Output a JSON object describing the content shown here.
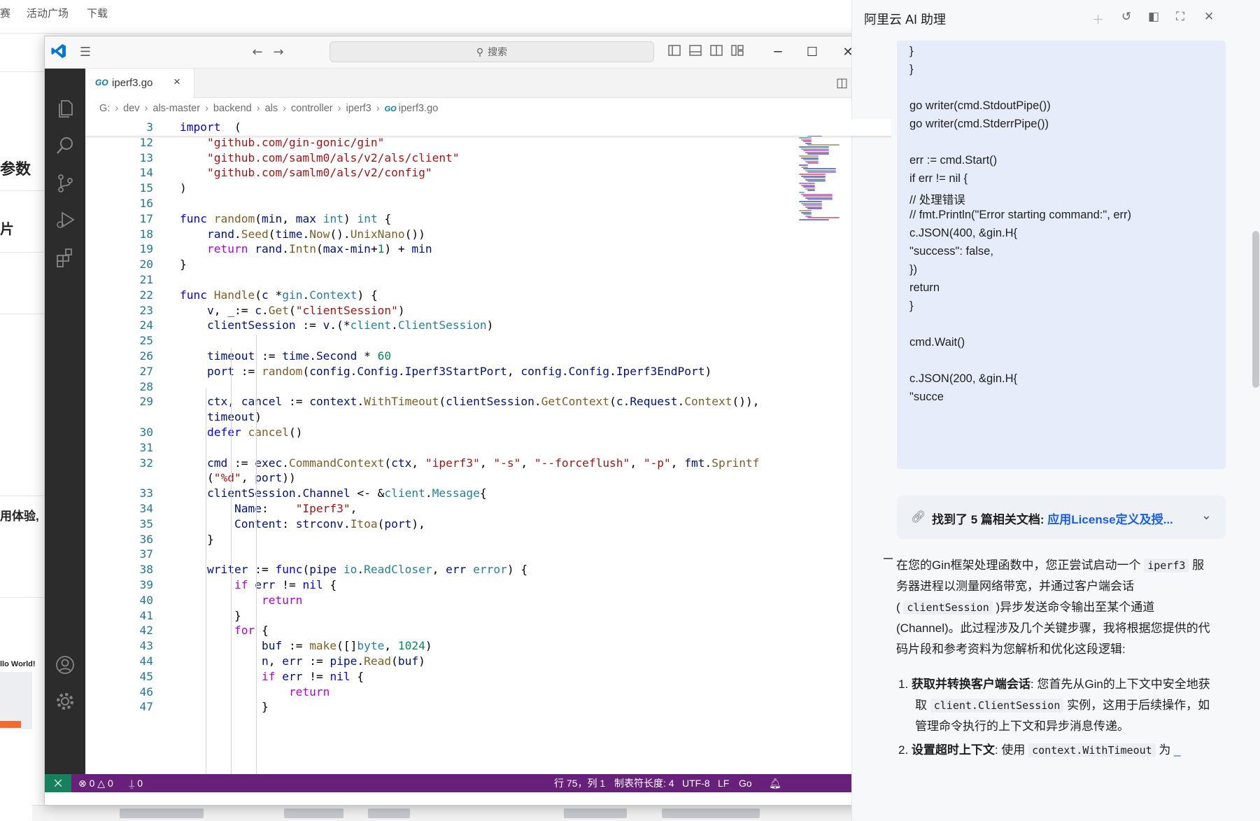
{
  "background": {
    "tabs": [
      "赛",
      "活动广场",
      "下载"
    ],
    "left_texts": [
      "参数",
      "片",
      "用体验,",
      "llo World!"
    ]
  },
  "vscode": {
    "search_placeholder": "搜索",
    "tab": {
      "icon": "go-file-icon",
      "go_mark": "GO",
      "filename": "iperf3.go",
      "close": "×"
    },
    "breadcrumb": [
      "G:",
      "dev",
      "als-master",
      "backend",
      "als",
      "controller",
      "iperf3",
      "iperf3.go"
    ],
    "status": {
      "errors": "0",
      "warnings": "0",
      "ports": "0",
      "position": "行 75，列 1",
      "tab_size": "制表符长度: 4",
      "encoding": "UTF-8",
      "eol": "LF",
      "language": "Go"
    }
  },
  "code_lines": [
    {
      "ln": "3",
      "tokens": [
        [
          "kw",
          "import"
        ],
        [
          "",
          "  ("
        ]
      ]
    },
    {
      "ln": "12",
      "tokens": [
        [
          "",
          "    "
        ],
        [
          "str",
          "\"github.com/gin-gonic/gin\""
        ]
      ]
    },
    {
      "ln": "13",
      "tokens": [
        [
          "",
          "    "
        ],
        [
          "str",
          "\"github.com/samlm0/als/v2/als/client\""
        ]
      ]
    },
    {
      "ln": "14",
      "tokens": [
        [
          "",
          "    "
        ],
        [
          "str",
          "\"github.com/samlm0/als/v2/config\""
        ]
      ]
    },
    {
      "ln": "15",
      "tokens": [
        [
          "",
          ")"
        ]
      ]
    },
    {
      "ln": "16",
      "tokens": []
    },
    {
      "ln": "17",
      "tokens": [
        [
          "kw",
          "func"
        ],
        [
          "",
          " "
        ],
        [
          "fn",
          "random"
        ],
        [
          "",
          "("
        ],
        [
          "id",
          "min"
        ],
        [
          "",
          ", "
        ],
        [
          "id",
          "max"
        ],
        [
          "",
          " "
        ],
        [
          "ty",
          "int"
        ],
        [
          "",
          ") "
        ],
        [
          "ty",
          "int"
        ],
        [
          "",
          " {"
        ]
      ]
    },
    {
      "ln": "18",
      "tokens": [
        [
          "",
          "    "
        ],
        [
          "id",
          "rand"
        ],
        [
          "",
          "."
        ],
        [
          "fn",
          "Seed"
        ],
        [
          "",
          "("
        ],
        [
          "id",
          "time"
        ],
        [
          "",
          "."
        ],
        [
          "fn",
          "Now"
        ],
        [
          "",
          "()."
        ],
        [
          "fn",
          "UnixNano"
        ],
        [
          "",
          "())"
        ]
      ]
    },
    {
      "ln": "19",
      "tokens": [
        [
          "",
          "    "
        ],
        [
          "ctl",
          "return"
        ],
        [
          "",
          " "
        ],
        [
          "id",
          "rand"
        ],
        [
          "",
          "."
        ],
        [
          "fn",
          "Intn"
        ],
        [
          "",
          "("
        ],
        [
          "id",
          "max"
        ],
        [
          "",
          "-"
        ],
        [
          "id",
          "min"
        ],
        [
          "",
          "+"
        ],
        [
          "num",
          "1"
        ],
        [
          "",
          ") + "
        ],
        [
          "id",
          "min"
        ]
      ]
    },
    {
      "ln": "20",
      "tokens": [
        [
          "",
          "}"
        ]
      ]
    },
    {
      "ln": "21",
      "tokens": []
    },
    {
      "ln": "22",
      "tokens": [
        [
          "kw",
          "func"
        ],
        [
          "",
          " "
        ],
        [
          "fn",
          "Handle"
        ],
        [
          "",
          "("
        ],
        [
          "id",
          "c"
        ],
        [
          "",
          " *"
        ],
        [
          "ty",
          "gin"
        ],
        [
          "",
          "."
        ],
        [
          "ty",
          "Context"
        ],
        [
          "",
          ") {"
        ]
      ]
    },
    {
      "ln": "23",
      "tokens": [
        [
          "",
          "    "
        ],
        [
          "id",
          "v"
        ],
        [
          "",
          ", "
        ],
        [
          "id",
          "_"
        ],
        [
          "",
          ":= "
        ],
        [
          "id",
          "c"
        ],
        [
          "",
          "."
        ],
        [
          "fn",
          "Get"
        ],
        [
          "",
          "("
        ],
        [
          "str",
          "\"clientSession\""
        ],
        [
          "",
          ")"
        ]
      ]
    },
    {
      "ln": "24",
      "tokens": [
        [
          "",
          "    "
        ],
        [
          "id",
          "clientSession"
        ],
        [
          "",
          " := "
        ],
        [
          "id",
          "v"
        ],
        [
          "",
          ".(*"
        ],
        [
          "ty",
          "client"
        ],
        [
          "",
          "."
        ],
        [
          "ty",
          "ClientSession"
        ],
        [
          "",
          ")"
        ]
      ]
    },
    {
      "ln": "25",
      "tokens": []
    },
    {
      "ln": "26",
      "tokens": [
        [
          "",
          "    "
        ],
        [
          "id",
          "timeout"
        ],
        [
          "",
          " := "
        ],
        [
          "id",
          "time"
        ],
        [
          "",
          "."
        ],
        [
          "id",
          "Second"
        ],
        [
          "",
          " * "
        ],
        [
          "num",
          "60"
        ]
      ]
    },
    {
      "ln": "27",
      "tokens": [
        [
          "",
          "    "
        ],
        [
          "id",
          "port"
        ],
        [
          "",
          " := "
        ],
        [
          "fn",
          "random"
        ],
        [
          "",
          "("
        ],
        [
          "id",
          "config"
        ],
        [
          "",
          "."
        ],
        [
          "id",
          "Config"
        ],
        [
          "",
          "."
        ],
        [
          "id",
          "Iperf3StartPort"
        ],
        [
          "",
          ", "
        ],
        [
          "id",
          "config"
        ],
        [
          "",
          "."
        ],
        [
          "id",
          "Config"
        ],
        [
          "",
          "."
        ],
        [
          "id",
          "Iperf3EndPort"
        ],
        [
          "",
          ")"
        ]
      ]
    },
    {
      "ln": "28",
      "tokens": []
    },
    {
      "ln": "29",
      "tokens": [
        [
          "",
          "    "
        ],
        [
          "id",
          "ctx"
        ],
        [
          "",
          ", "
        ],
        [
          "id",
          "cancel"
        ],
        [
          "",
          " := "
        ],
        [
          "id",
          "context"
        ],
        [
          "",
          "."
        ],
        [
          "fn",
          "WithTimeout"
        ],
        [
          "",
          "("
        ],
        [
          "id",
          "clientSession"
        ],
        [
          "",
          "."
        ],
        [
          "fn",
          "GetContext"
        ],
        [
          "",
          "("
        ],
        [
          "id",
          "c"
        ],
        [
          "",
          "."
        ],
        [
          "id",
          "Request"
        ],
        [
          "",
          "."
        ],
        [
          "fn",
          "Context"
        ],
        [
          "",
          "()),"
        ]
      ]
    },
    {
      "ln": "",
      "tokens": [
        [
          "",
          "    "
        ],
        [
          "id",
          "timeout"
        ],
        [
          "",
          ")"
        ]
      ]
    },
    {
      "ln": "30",
      "tokens": [
        [
          "",
          "    "
        ],
        [
          "kw",
          "defer"
        ],
        [
          "",
          " "
        ],
        [
          "fn",
          "cancel"
        ],
        [
          "",
          "()"
        ]
      ]
    },
    {
      "ln": "31",
      "tokens": []
    },
    {
      "ln": "32",
      "tokens": [
        [
          "",
          "    "
        ],
        [
          "id",
          "cmd"
        ],
        [
          "",
          " := "
        ],
        [
          "id",
          "exec"
        ],
        [
          "",
          "."
        ],
        [
          "fn",
          "CommandContext"
        ],
        [
          "",
          "("
        ],
        [
          "id",
          "ctx"
        ],
        [
          "",
          ", "
        ],
        [
          "str",
          "\"iperf3\""
        ],
        [
          "",
          ", "
        ],
        [
          "str",
          "\"-s\""
        ],
        [
          "",
          ", "
        ],
        [
          "str",
          "\"--forceflush\""
        ],
        [
          "",
          ", "
        ],
        [
          "str",
          "\"-p\""
        ],
        [
          "",
          ", "
        ],
        [
          "id",
          "fmt"
        ],
        [
          "",
          "."
        ],
        [
          "fn",
          "Sprintf"
        ]
      ]
    },
    {
      "ln": "",
      "tokens": [
        [
          "",
          "    ("
        ],
        [
          "str",
          "\"%d\""
        ],
        [
          "",
          ", "
        ],
        [
          "id",
          "port"
        ],
        [
          "",
          "))"
        ]
      ]
    },
    {
      "ln": "33",
      "tokens": [
        [
          "",
          "    "
        ],
        [
          "id",
          "clientSession"
        ],
        [
          "",
          "."
        ],
        [
          "id",
          "Channel"
        ],
        [
          "",
          " <- &"
        ],
        [
          "ty",
          "client"
        ],
        [
          "",
          "."
        ],
        [
          "ty",
          "Message"
        ],
        [
          "",
          "{"
        ]
      ]
    },
    {
      "ln": "34",
      "tokens": [
        [
          "",
          "        "
        ],
        [
          "id",
          "Name"
        ],
        [
          "",
          ":    "
        ],
        [
          "str",
          "\"Iperf3\""
        ],
        [
          "",
          ","
        ]
      ]
    },
    {
      "ln": "35",
      "tokens": [
        [
          "",
          "        "
        ],
        [
          "id",
          "Content"
        ],
        [
          "",
          ": "
        ],
        [
          "id",
          "strconv"
        ],
        [
          "",
          "."
        ],
        [
          "fn",
          "Itoa"
        ],
        [
          "",
          "("
        ],
        [
          "id",
          "port"
        ],
        [
          "",
          "),"
        ]
      ]
    },
    {
      "ln": "36",
      "tokens": [
        [
          "",
          "    }"
        ]
      ]
    },
    {
      "ln": "37",
      "tokens": []
    },
    {
      "ln": "38",
      "tokens": [
        [
          "",
          "    "
        ],
        [
          "id",
          "writer"
        ],
        [
          "",
          " := "
        ],
        [
          "kw",
          "func"
        ],
        [
          "",
          "("
        ],
        [
          "id",
          "pipe"
        ],
        [
          "",
          " "
        ],
        [
          "ty",
          "io"
        ],
        [
          "",
          "."
        ],
        [
          "ty",
          "ReadCloser"
        ],
        [
          "",
          ", "
        ],
        [
          "id",
          "err"
        ],
        [
          "",
          " "
        ],
        [
          "ty",
          "error"
        ],
        [
          "",
          ") {"
        ]
      ]
    },
    {
      "ln": "39",
      "tokens": [
        [
          "",
          "        "
        ],
        [
          "ctl",
          "if"
        ],
        [
          "",
          " "
        ],
        [
          "id",
          "err"
        ],
        [
          "",
          " != "
        ],
        [
          "kw",
          "nil"
        ],
        [
          "",
          " {"
        ]
      ]
    },
    {
      "ln": "40",
      "tokens": [
        [
          "",
          "            "
        ],
        [
          "ctl",
          "return"
        ]
      ]
    },
    {
      "ln": "41",
      "tokens": [
        [
          "",
          "        }"
        ]
      ]
    },
    {
      "ln": "42",
      "tokens": [
        [
          "",
          "        "
        ],
        [
          "ctl",
          "for"
        ],
        [
          "",
          " {"
        ]
      ]
    },
    {
      "ln": "43",
      "tokens": [
        [
          "",
          "            "
        ],
        [
          "id",
          "buf"
        ],
        [
          "",
          " := "
        ],
        [
          "fn",
          "make"
        ],
        [
          "",
          "([]"
        ],
        [
          "ty",
          "byte"
        ],
        [
          "",
          ", "
        ],
        [
          "num",
          "1024"
        ],
        [
          "",
          ")"
        ]
      ]
    },
    {
      "ln": "44",
      "tokens": [
        [
          "",
          "            "
        ],
        [
          "id",
          "n"
        ],
        [
          "",
          ", "
        ],
        [
          "id",
          "err"
        ],
        [
          "",
          " := "
        ],
        [
          "id",
          "pipe"
        ],
        [
          "",
          "."
        ],
        [
          "fn",
          "Read"
        ],
        [
          "",
          "("
        ],
        [
          "id",
          "buf"
        ],
        [
          "",
          ")"
        ]
      ]
    },
    {
      "ln": "45",
      "tokens": [
        [
          "",
          "            "
        ],
        [
          "ctl",
          "if"
        ],
        [
          "",
          " "
        ],
        [
          "id",
          "err"
        ],
        [
          "",
          " != "
        ],
        [
          "kw",
          "nil"
        ],
        [
          "",
          " {"
        ]
      ]
    },
    {
      "ln": "46",
      "tokens": [
        [
          "",
          "                "
        ],
        [
          "ctl",
          "return"
        ]
      ]
    },
    {
      "ln": "47",
      "tokens": [
        [
          "",
          "            }"
        ]
      ]
    }
  ],
  "assistant": {
    "title": "阿里云 AI 助理",
    "code_lines": [
      "}",
      "}",
      "",
      "go writer(cmd.StdoutPipe())",
      "go writer(cmd.StderrPipe())",
      "",
      "err := cmd.Start()",
      "if err != nil {",
      "// 处理错误",
      "// fmt.Println(\"Error starting command:\", err)",
      "c.JSON(400, &gin.H{",
      "\"success\": false,",
      "})",
      "return",
      "}",
      "",
      "cmd.Wait()",
      "",
      "c.JSON(200, &gin.H{",
      "\"succe"
    ],
    "docs_prefix": "找到了 5 篇相关文档: ",
    "docs_link": "应用License定义及授...",
    "para1": [
      [
        "在您的Gin框架处理函数中，您正尝试启动一个",
        "iperf3",
        "服"
      ],
      [
        "务器进程以测量网络带宽，并通过客户端会话"
      ],
      [
        "(",
        "clientSession",
        ")异步发送命令输出至某个通道"
      ],
      [
        "(Channel)。此过程涉及几个关键步骤，我将根据您提供的代"
      ],
      [
        "码片段和参考资料为您解析和优化这段逻辑:"
      ]
    ],
    "item1_title": "获取并转换客户端会话",
    "item1_lines": [
      ": 您首先从Gin的上下文中安全地获",
      "取",
      "client.ClientSession",
      "实例，这用于后续操作，如",
      "管理命令执行的上下文和异步消息传递。"
    ],
    "item2_title": "设置超时上下文",
    "item2_text": ": 使用",
    "item2_code": "context.WithTimeout",
    "item2_tail": "为"
  }
}
